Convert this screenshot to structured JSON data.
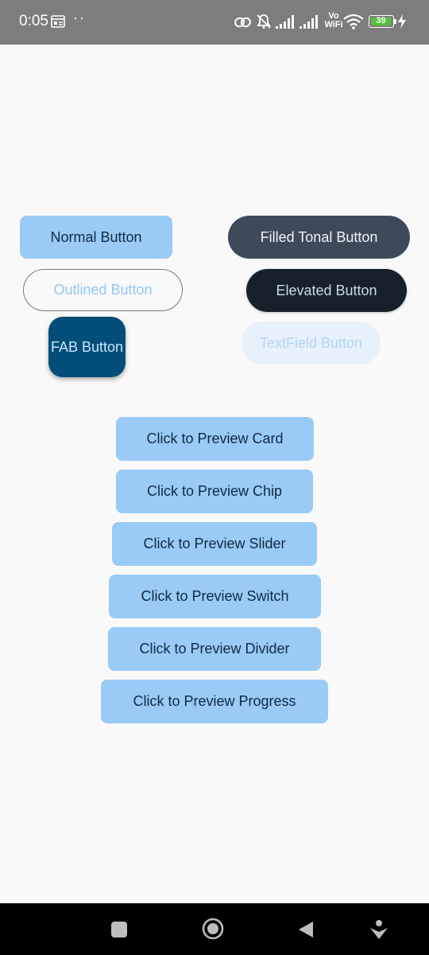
{
  "status_bar": {
    "time": "0:05",
    "dots": "··",
    "network_label_top": "Vo",
    "network_label_bottom": "WiFi",
    "battery": "39",
    "icons": [
      "gallery-icon",
      "link-icon",
      "mute-icon",
      "signal-icon",
      "signal-icon",
      "vowifi-icon",
      "wifi-icon",
      "battery-icon",
      "charging-icon"
    ]
  },
  "buttons": {
    "normal": "Normal Button",
    "filled_tonal": "Filled Tonal Button",
    "outlined": "Outlined Button",
    "elevated": "Elevated Button",
    "fab": "FAB Button",
    "textfield": "TextField Button"
  },
  "previews": {
    "card": "Click to Preview Card",
    "chip": "Click to Preview Chip",
    "slider": "Click to Preview Slider",
    "switch": "Click to Preview Switch",
    "divider": "Click to Preview Divider",
    "progress": "Click to Preview Progress"
  },
  "nav_bar": {
    "icons": [
      "recents-icon",
      "home-icon",
      "back-icon",
      "assistant-icon"
    ]
  },
  "colors": {
    "primary_container": "#99cbf6",
    "tonal": "#3d4a5a",
    "elevated": "#17212b",
    "fab": "#034e78",
    "background": "#f9f9f9"
  }
}
